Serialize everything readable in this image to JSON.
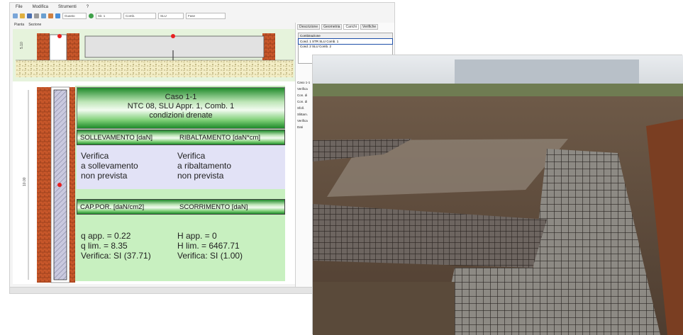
{
  "menu": [
    "File",
    "Modifica",
    "Strumenti",
    "?"
  ],
  "toolbar": {
    "combo1": "Guasto",
    "combo2": "Sit. 1",
    "combo3": "Comb.",
    "combo4": "SLU",
    "combo5": "Fase"
  },
  "tabs": [
    "Pianta",
    "Sezione"
  ],
  "right_panel": {
    "tabs": [
      "Descrizione",
      "Geometria",
      "Carichi",
      "Verifiche"
    ],
    "list_header": "Combinazione",
    "list_rows": [
      "Cond. 1 STR  SLU  Comb. 1",
      "Cond. 2 SLU  Comb. 2"
    ],
    "lower_items": [
      "Caso 1-1",
      "Verifica",
      "Con. di",
      "Con. di",
      "Sfoll.",
      "Slittam.",
      "Verifica",
      "Dati"
    ]
  },
  "case": {
    "line1": "Caso 1-1",
    "line2": "NTC 08, SLU Appr. 1, Comb. 1",
    "line3": "condizioni drenate"
  },
  "table": {
    "h1": "SOLLEVAMENTO [daN]",
    "h2": "RIBALTAMENTO [daN*cm]",
    "r1c1": [
      "Verifica",
      "a sollevamento",
      "non prevista"
    ],
    "r1c2": [
      "Verifica",
      "a ribaltamento",
      "non prevista"
    ],
    "h3": "CAP.POR. [daN/cm2]",
    "h4": "SCORRIMENTO [daN]",
    "r2c1": [
      "q app. = 0.22",
      "q lim. = 8.35",
      "Verifica: SI (37.71)"
    ],
    "r2c2": [
      "H app. = 0",
      "H lim. = 6467.71",
      "Verifica: SI (1.00)"
    ]
  },
  "colors": {
    "panel_green": "#c8f0c0",
    "header_green": "#1f8a2a",
    "lavender": "#e2e2f6",
    "brick": "#c8572a",
    "marker": "#e82020"
  },
  "photo_subject": "foundation rebar cage on construction site"
}
